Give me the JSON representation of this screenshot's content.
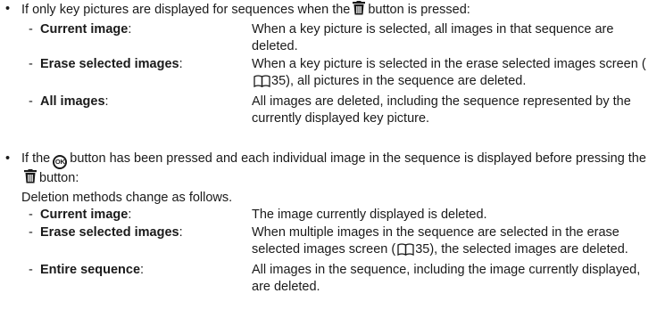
{
  "bullet_char": "•",
  "dash_char": "-",
  "top_fragment": "the",
  "section1": {
    "intro_before": "If only key pictures are displayed for sequences when the",
    "intro_after": "button is pressed:",
    "items": [
      {
        "term": "Current image",
        "colon": ":",
        "desc": "When a key picture is selected, all images in that sequence are deleted."
      },
      {
        "term": "Erase selected images",
        "colon": ":",
        "desc_before": "When a key picture is selected in the erase selected images screen (",
        "page_ref": "35",
        "desc_after": "), all pictures in the sequence are deleted."
      },
      {
        "term": "All images",
        "colon": ":",
        "desc": "All images are deleted, including the sequence represented by the currently displayed key picture."
      }
    ]
  },
  "section2": {
    "intro_a": "If the",
    "ok_label": "OK",
    "intro_b": "button has been pressed and each individual image in the sequence is displayed before pressing the",
    "intro_c": "button:",
    "subtext": "Deletion methods change as follows.",
    "items": [
      {
        "term": "Current image",
        "colon": ":",
        "desc": "The image currently displayed is deleted."
      },
      {
        "term": "Erase selected images",
        "colon": ":",
        "desc_before": "When multiple images in the sequence are selected in the erase selected images screen (",
        "page_ref": "35",
        "desc_after": "), the selected images are deleted."
      },
      {
        "term": "Entire sequence",
        "colon": ":",
        "desc": "All images in the sequence, including the image currently displayed, are deleted."
      }
    ]
  },
  "icons": {
    "trash": "trash-icon",
    "ok": "ok-button-icon",
    "book": "book-reference-icon"
  }
}
